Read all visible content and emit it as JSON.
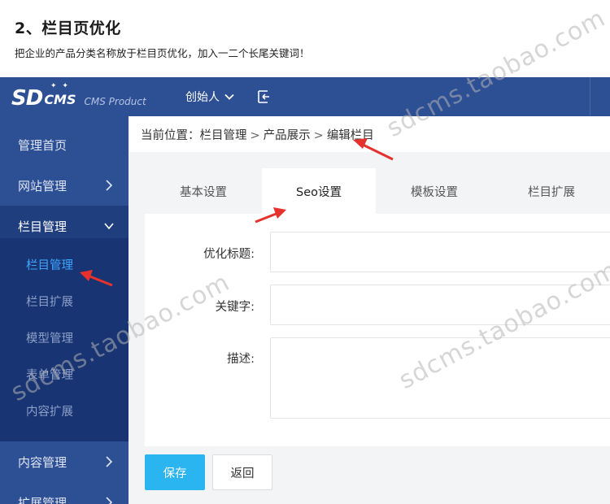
{
  "doc": {
    "title": "2、栏目页优化",
    "description": "把企业的产品分类名称放于栏目页优化，加入一二个长尾关键词！"
  },
  "topbar": {
    "logo_main": "SD",
    "logo_cms": "CMS",
    "logo_product": "CMS Product",
    "user_label": "创始人",
    "icons": [
      "chevron-down-icon",
      "collapse-icon"
    ]
  },
  "sidebar": {
    "items": [
      {
        "label": "管理首页"
      },
      {
        "label": "网站管理"
      },
      {
        "label": "栏目管理"
      },
      {
        "label": "内容管理"
      },
      {
        "label": "扩展管理"
      }
    ],
    "submenu": [
      {
        "label": "栏目管理"
      },
      {
        "label": "栏目扩展"
      },
      {
        "label": "模型管理"
      },
      {
        "label": "表单管理"
      },
      {
        "label": "内容扩展"
      }
    ]
  },
  "breadcrumb": {
    "prefix": "当前位置：",
    "items": [
      "栏目管理",
      "产品展示",
      "编辑栏目"
    ],
    "separator": ">"
  },
  "tabs": [
    {
      "label": "基本设置"
    },
    {
      "label": "Seo设置"
    },
    {
      "label": "模板设置"
    },
    {
      "label": "栏目扩展"
    }
  ],
  "form": {
    "seo_title_label": "优化标题:",
    "keywords_label": "关键字:",
    "description_label": "描述:"
  },
  "buttons": {
    "save": "保存",
    "back": "返回"
  },
  "watermark": "sdcms.taobao.com",
  "colors": {
    "nav_bg": "#2d4f94",
    "submenu_bg": "#183473",
    "active_link": "#3fa6ff",
    "save_button": "#2ab4f0",
    "annotation_arrow": "#e5322d"
  }
}
